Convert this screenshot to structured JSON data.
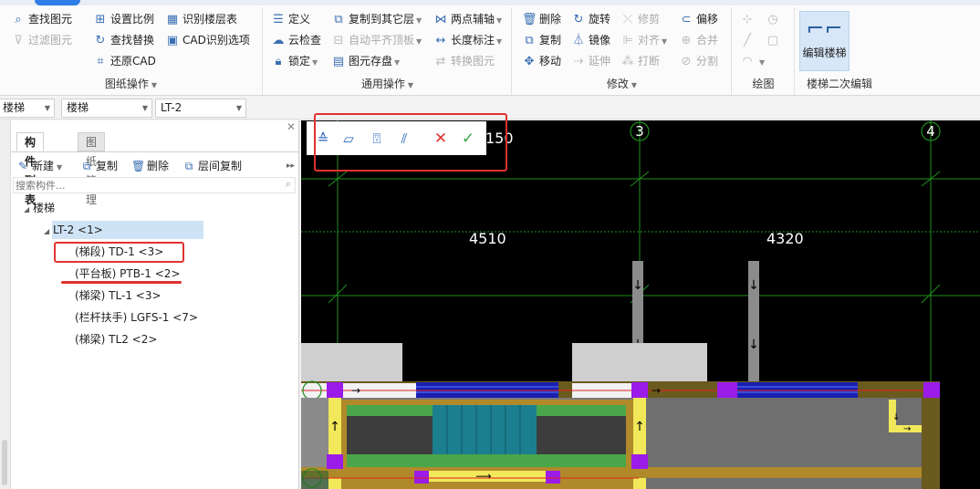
{
  "ribbon": {
    "groups": {
      "drawing_ops": {
        "title": "图纸操作",
        "items": [
          "查找图元",
          "过滤图元",
          "设置比例",
          "查找替换",
          "还原CAD",
          "识别楼层表",
          "CAD识别选项"
        ]
      },
      "general_ops": {
        "title": "通用操作",
        "items": [
          "定义",
          "云检查",
          "锁定",
          "复制到其它层",
          "自动平齐顶板",
          "图元存盘",
          "两点辅轴",
          "长度标注",
          "转换图元"
        ]
      },
      "modify": {
        "title": "修改",
        "items": [
          "删除",
          "复制",
          "移动",
          "旋转",
          "镜像",
          "延伸",
          "修剪",
          "对齐",
          "打断",
          "偏移",
          "合并",
          "分割"
        ]
      },
      "draw": {
        "title": "绘图"
      },
      "stair_edit": {
        "title": "楼梯二次编辑",
        "button": "编辑楼梯"
      }
    }
  },
  "filters": {
    "category": "楼梯",
    "type": "楼梯",
    "member": "LT-2"
  },
  "panel": {
    "tabs": [
      "构件列表",
      "图纸管理"
    ],
    "tools": [
      "新建",
      "复制",
      "删除",
      "层间复制"
    ],
    "search_placeholder": "搜索构件...",
    "tree": {
      "root": "楼梯",
      "selected": "LT-2 <1>",
      "children": [
        "(梯段) TD-1 <3>",
        "(平台板) PTB-1 <2>",
        "(梯梁) TL-1 <3>",
        "(栏杆扶手) LGFS-1 <7>",
        "(梯梁) TL2 <2>"
      ]
    }
  },
  "canvas": {
    "axis_labels": [
      "3",
      "4"
    ],
    "dims": [
      "4510",
      "4320",
      "150"
    ]
  },
  "float_toolbar": {
    "icons": [
      "stair-flight-icon",
      "platform-slab-icon",
      "stair-beam-icon",
      "railing-icon",
      "cancel-icon",
      "confirm-icon"
    ]
  },
  "colors": {
    "annotation_red": "#e0322f",
    "selection_blue": "#cfe3f7",
    "accent": "#2f7fe6"
  }
}
